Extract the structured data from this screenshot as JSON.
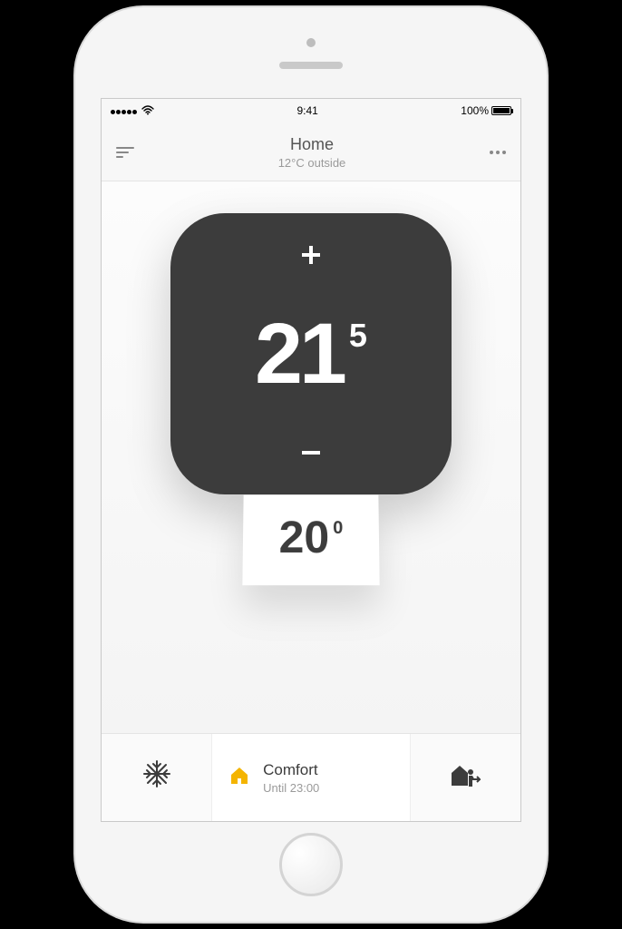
{
  "status_bar": {
    "time": "9:41",
    "battery_text": "100%"
  },
  "header": {
    "title": "Home",
    "subtitle": "12°C outside"
  },
  "thermostat": {
    "setpoint_whole": "21",
    "setpoint_frac": "5",
    "current_whole": "20",
    "current_frac": "0"
  },
  "mode": {
    "label": "Comfort",
    "until": "Until 23:00"
  }
}
